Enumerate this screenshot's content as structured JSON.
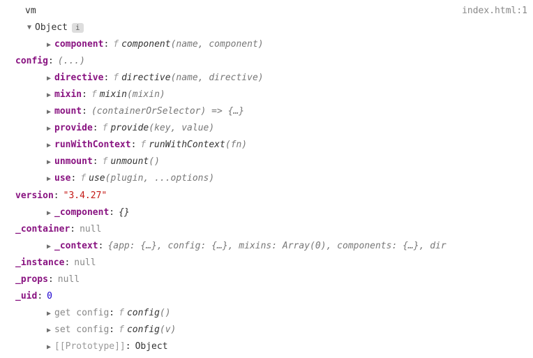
{
  "top": {
    "expr": "vm",
    "source": "index.html:1"
  },
  "root": {
    "label": "Object",
    "badge": "i"
  },
  "props": {
    "component": {
      "key": "component",
      "sig_name": "component",
      "sig_args": "(name, component)"
    },
    "config": {
      "key": "config",
      "placeholder": "(...)"
    },
    "directive": {
      "key": "directive",
      "sig_name": "directive",
      "sig_args": "(name, directive)"
    },
    "mixin": {
      "key": "mixin",
      "sig_name": "mixin",
      "sig_args": "(mixin)"
    },
    "mount": {
      "key": "mount",
      "arrow": "(containerOrSelector) => {…}"
    },
    "provide": {
      "key": "provide",
      "sig_name": "provide",
      "sig_args": "(key, value)"
    },
    "runWithContext": {
      "key": "runWithContext",
      "sig_name": "runWithContext",
      "sig_args": "(fn)"
    },
    "unmount": {
      "key": "unmount",
      "sig_name": "unmount",
      "sig_args": "()"
    },
    "use": {
      "key": "use",
      "sig_name": "use",
      "sig_args": "(plugin, ...options)"
    },
    "version": {
      "key": "version",
      "value": "\"3.4.27\""
    },
    "_component": {
      "key": "_component",
      "value": "{}"
    },
    "_container": {
      "key": "_container",
      "value": "null"
    },
    "_context": {
      "key": "_context",
      "preview": "{app: {…}, config: {…}, mixins: Array(0), components: {…}, dir"
    },
    "_instance": {
      "key": "_instance",
      "value": "null"
    },
    "_props": {
      "key": "_props",
      "value": "null"
    },
    "_uid": {
      "key": "_uid",
      "value": "0"
    },
    "get_config": {
      "key": "get config",
      "sig_name": "config",
      "sig_args": "()"
    },
    "set_config": {
      "key": "set config",
      "sig_name": "config",
      "sig_args": "(v)"
    },
    "prototype": {
      "key": "[[Prototype]]",
      "value": "Object"
    }
  }
}
